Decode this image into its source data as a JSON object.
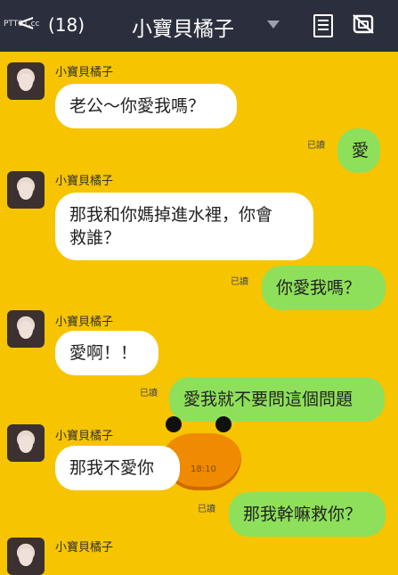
{
  "header": {
    "watermark": "PTT01.cc",
    "back_symbol": "<",
    "unread_count": "(18)",
    "chat_title": "小寶貝橘子",
    "icons": [
      "chevron-down-icon",
      "note-icon",
      "video-call-icon"
    ]
  },
  "messages": [
    {
      "side": "left",
      "sender": "小寶貝橘子",
      "text": "老公～你愛我嗎？"
    },
    {
      "side": "right",
      "read": "已讀",
      "text": "愛"
    },
    {
      "side": "left",
      "sender": "小寶貝橘子",
      "line1": "那我和你媽掉進水裡，你會",
      "line2": "救誰？"
    },
    {
      "side": "right",
      "read": "已讀",
      "text": "你愛我嗎？"
    },
    {
      "side": "left",
      "sender": "小寶貝橘子",
      "text": "愛啊！！"
    },
    {
      "side": "right",
      "read": "已讀",
      "text": "愛我就不要問這個問題"
    },
    {
      "side": "left",
      "sender": "小寶貝橘子",
      "text": "那我不愛你",
      "time": "18:10"
    },
    {
      "side": "right",
      "read": "已讀",
      "text": "那我幹嘛救你？"
    },
    {
      "side": "left",
      "sender": "小寶貝橘子"
    }
  ],
  "colors": {
    "background": "#f6c400",
    "header": "#2b2f3d",
    "own_bubble": "#8ee05a",
    "other_bubble": "#ffffff",
    "duck_beak": "#f08a00"
  }
}
